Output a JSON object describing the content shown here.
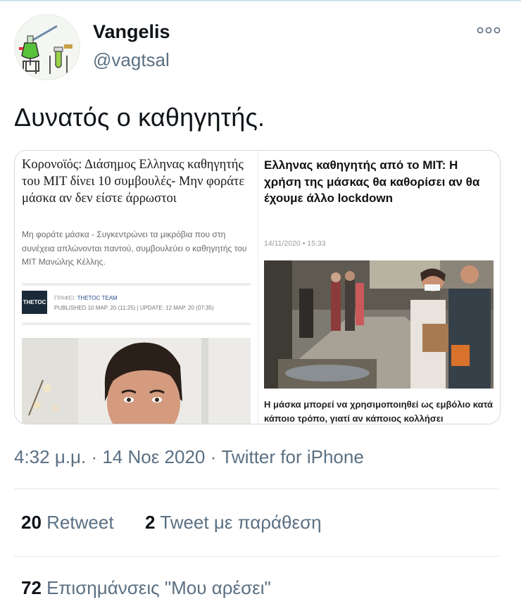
{
  "author": {
    "name": "Vangelis",
    "handle": "@vagtsal"
  },
  "tweet": {
    "text": "Δυνατός ο καθηγητής."
  },
  "card_left": {
    "title": "Κορονοϊός: Διάσημος Ελληνας καθηγητής του ΜΙΤ δίνει 10 συμβουλές- Μην φοράτε μάσκα αν δεν είστε άρρωστοι",
    "lede": "Μη φοράτε μάσκα - Συγκεντρώνει τα μικρόβια που στη συνέχεια απλώνονται παντού, συμβουλεύει ο καθηγητής του ΜΙΤ Μανώλης Κέλλης.",
    "logo": "THETOC",
    "author_prefix": "ΓΡΑΦΕΙ:",
    "author": "THETOC TEAM",
    "published": "PUBLISHED 10 ΜΑΡ. 20 (11:25) | UPDATE: 12 ΜΑΡ. 20 (07:35)"
  },
  "card_right": {
    "title": "Ελληνας καθηγητής από το MIT: Η χρήση της μάσκας θα καθορίσει αν θα έχουμε άλλο lockdown",
    "date": "14/11/2020",
    "time": "15:33",
    "caption": "Η μάσκα μπορεί να χρησιμοποιηθεί ως εμβόλιο κατά κάποιο τρόπο, γιατί αν κάποιος κολλήσει"
  },
  "meta": "4:32 μ.μ. · 14 Νοε 2020 · Twitter for iPhone",
  "stats": {
    "retweets_count": "20",
    "retweets_label": "Retweet",
    "quotes_count": "2",
    "quotes_label": "Tweet με παράθεση",
    "likes_count": "72",
    "likes_label": "Επισημάνσεις \"Μου αρέσει\""
  },
  "icons": {
    "more": "more-options-icon",
    "verified": "none"
  },
  "colors": {
    "secondary_text": "#5b7083",
    "divider": "#e1e8ed",
    "thetoc_logo": "#1b2a39"
  }
}
